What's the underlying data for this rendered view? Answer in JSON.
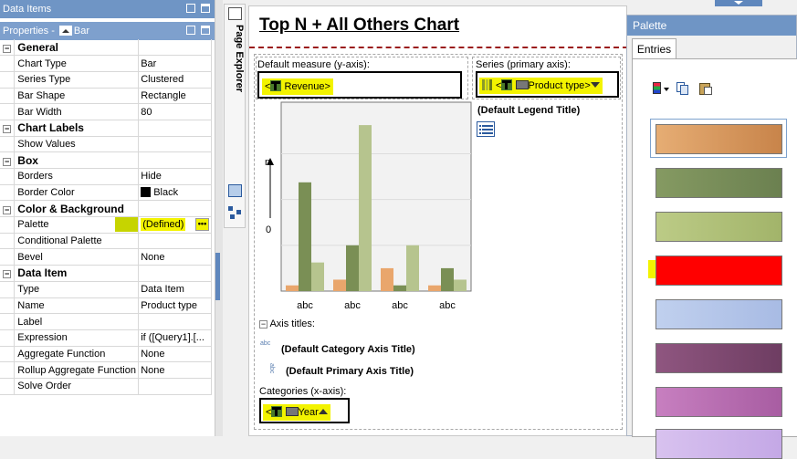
{
  "data_items": {
    "title": "Data Items"
  },
  "properties": {
    "title_prefix": "Properties - ",
    "object": "Bar"
  },
  "property_groups": [
    {
      "name": "General",
      "rows": [
        {
          "name": "Chart Type",
          "value": "Bar"
        },
        {
          "name": "Series Type",
          "value": "Clustered"
        },
        {
          "name": "Bar Shape",
          "value": "Rectangle"
        },
        {
          "name": "Bar Width",
          "value": "80"
        }
      ]
    },
    {
      "name": "Chart Labels",
      "rows": [
        {
          "name": "Show Values",
          "value": ""
        }
      ]
    },
    {
      "name": "Box",
      "rows": [
        {
          "name": "Borders",
          "value": "Hide"
        },
        {
          "name": "Border Color",
          "value": "Black"
        }
      ]
    },
    {
      "name": "Color & Background",
      "rows": [
        {
          "name": "Palette",
          "value": "(Defined)"
        },
        {
          "name": "Conditional Palette",
          "value": ""
        },
        {
          "name": "Bevel",
          "value": "None"
        }
      ]
    },
    {
      "name": "Data Item",
      "rows": [
        {
          "name": "Type",
          "value": "Data Item"
        },
        {
          "name": "Name",
          "value": "Product type"
        },
        {
          "name": "Label",
          "value": ""
        },
        {
          "name": "Expression",
          "value": "if ([Query1].[..."
        },
        {
          "name": "Aggregate Function",
          "value": "None"
        },
        {
          "name": "Rollup Aggregate Function",
          "value": "None"
        },
        {
          "name": "Solve Order",
          "value": ""
        }
      ]
    }
  ],
  "strip": {
    "label": "Page Explorer"
  },
  "report": {
    "title": "Top N + All Others Chart",
    "measure_label": "Default measure (y-axis):",
    "measure_item": "Revenue",
    "series_label": "Series (primary axis):",
    "series_item": "Product type",
    "legend_title": "(Default Legend Title)",
    "axis_titles_label": "Axis titles:",
    "category_axis_title": "(Default Category Axis Title)",
    "primary_axis_title": "(Default Primary Axis Title)",
    "categories_label": "Categories (x-axis):",
    "categories_item": "Year",
    "y_tick_n": "n",
    "y_tick_0": "0",
    "icon_abc_small": "abc"
  },
  "chart_data": {
    "type": "bar",
    "categories": [
      "abc",
      "abc",
      "abc",
      "abc"
    ],
    "series": [
      {
        "values": [
          1,
          2,
          4,
          1
        ]
      },
      {
        "values": [
          19,
          8,
          1,
          4
        ]
      },
      {
        "values": [
          5,
          29,
          8,
          2
        ]
      }
    ],
    "series_colors": [
      "#e9a66c",
      "#7a8f55",
      "#b6c48e"
    ],
    "ylim": [
      0,
      33
    ],
    "grid": true
  },
  "palette": {
    "title": "Palette",
    "tab": "Entries",
    "entries": [
      {
        "color_from": "#e6ad74",
        "color_to": "#c8844a"
      },
      {
        "color_from": "#859a62",
        "color_to": "#6b8050"
      },
      {
        "color_from": "#bccb86",
        "color_to": "#a2b46a"
      },
      {
        "color_from": "#ff0000",
        "color_to": "#ff0000"
      },
      {
        "color_from": "#c0d0ee",
        "color_to": "#a8bbe4"
      },
      {
        "color_from": "#8f5680",
        "color_to": "#6e3d62"
      },
      {
        "color_from": "#c77fc0",
        "color_to": "#a85da2"
      },
      {
        "color_from": "#d8c2ef",
        "color_to": "#c4a8e6"
      }
    ]
  }
}
